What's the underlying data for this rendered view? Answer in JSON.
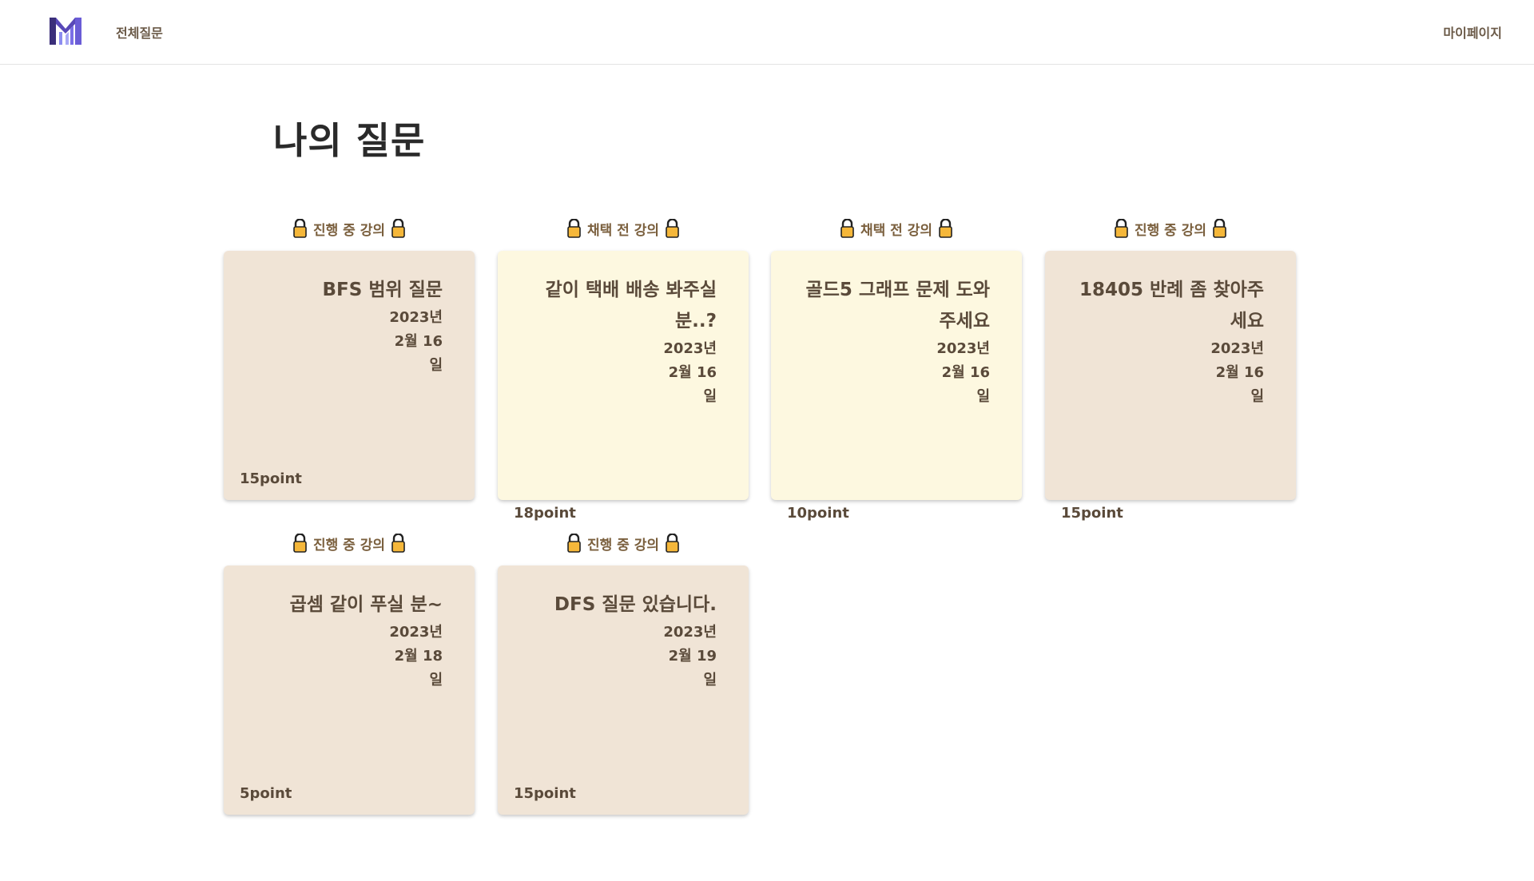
{
  "nav": {
    "all_questions": "전체질문",
    "my_page": "마이페이지"
  },
  "brand": {
    "logo_icon": "m-logo-icon",
    "colors": [
      "#3b2f7a",
      "#8c8cf0"
    ]
  },
  "page": {
    "title": "나의 질문"
  },
  "colors": {
    "card_beige": "#f0e4d6",
    "card_cream": "#fdf8e0",
    "lock": "#f5b73a"
  },
  "questions": [
    {
      "status": "진행 중 강의",
      "title": "BFS 범위 질문",
      "date": "2023년 2월 16 일",
      "points": "15point",
      "status_icon": "lock-icon"
    },
    {
      "status": "채택 전 강의",
      "title": "같이 택배 배송 봐주실 분..?",
      "date": "2023년 2월 16 일",
      "points": "18point",
      "status_icon": "lock-icon"
    },
    {
      "status": "채택 전 강의",
      "title": "골드5 그래프 문제 도와주세요",
      "date": "2023년 2월 16 일",
      "points": "10point",
      "status_icon": "lock-icon"
    },
    {
      "status": "진행 중 강의",
      "title": "18405 반례 좀 찾아주세요",
      "date": "2023년 2월 16 일",
      "points": "15point",
      "status_icon": "lock-icon"
    },
    {
      "status": "진행 중 강의",
      "title": "곱셈 같이 푸실 분~",
      "date": "2023년 2월 18 일",
      "points": "5point",
      "status_icon": "lock-icon"
    },
    {
      "status": "진행 중 강의",
      "title": "DFS 질문 있습니다.",
      "date": "2023년 2월 19 일",
      "points": "15point",
      "status_icon": "lock-icon"
    }
  ]
}
